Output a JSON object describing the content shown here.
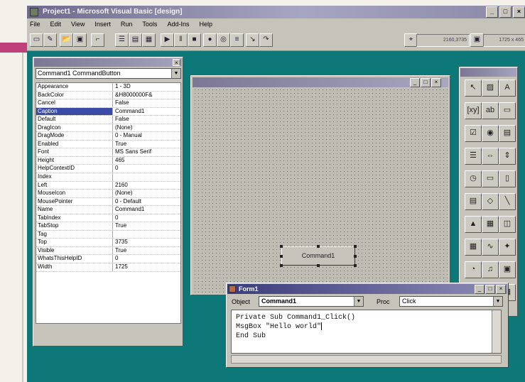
{
  "window": {
    "title": "Project1 - Microsoft Visual Basic [design]"
  },
  "menu": [
    "File",
    "Edit",
    "View",
    "Insert",
    "Run",
    "Tools",
    "Add-Ins",
    "Help"
  ],
  "toolbar": {
    "position_readout": "2160,3735",
    "size_readout": "1725 x 465"
  },
  "properties": {
    "object_selector": "Command1  CommandButton",
    "rows": [
      {
        "name": "Appearance",
        "value": "1 - 3D"
      },
      {
        "name": "BackColor",
        "value": "&H8000000F&"
      },
      {
        "name": "Cancel",
        "value": "False"
      },
      {
        "name": "Caption",
        "value": "Command1"
      },
      {
        "name": "Default",
        "value": "False"
      },
      {
        "name": "DragIcon",
        "value": "(None)"
      },
      {
        "name": "DragMode",
        "value": "0 - Manual"
      },
      {
        "name": "Enabled",
        "value": "True"
      },
      {
        "name": "Font",
        "value": "MS Sans Serif"
      },
      {
        "name": "Height",
        "value": "465"
      },
      {
        "name": "HelpContextID",
        "value": "0"
      },
      {
        "name": "Index",
        "value": ""
      },
      {
        "name": "Left",
        "value": "2160"
      },
      {
        "name": "MouseIcon",
        "value": "(None)"
      },
      {
        "name": "MousePointer",
        "value": "0 - Default"
      },
      {
        "name": "Name",
        "value": "Command1"
      },
      {
        "name": "TabIndex",
        "value": "0"
      },
      {
        "name": "TabStop",
        "value": "True"
      },
      {
        "name": "Tag",
        "value": ""
      },
      {
        "name": "Top",
        "value": "3735"
      },
      {
        "name": "Visible",
        "value": "True"
      },
      {
        "name": "WhatsThisHelpID",
        "value": "0"
      },
      {
        "name": "Width",
        "value": "1725"
      }
    ],
    "selected_row": "Caption"
  },
  "form": {
    "button_caption": "Command1"
  },
  "code_window": {
    "title": "Form1",
    "object_label": "Object",
    "object_value": "Command1",
    "proc_label": "Proc",
    "proc_value": "Click",
    "lines": [
      "Private Sub Command1_Click()",
      "MsgBox \"Hello world\"",
      "End Sub"
    ]
  },
  "toolbox_icons": [
    "pointer",
    "picturebox",
    "label",
    "frame",
    "textbox",
    "commandbutton",
    "checkbox",
    "optionbutton",
    "combobox",
    "listbox",
    "hscroll",
    "vscroll",
    "timer",
    "drivelist",
    "dirlist",
    "filelist",
    "shape",
    "line",
    "image",
    "data",
    "ole",
    "grid",
    "graph",
    "spin",
    "gauge",
    "mci",
    "commondialog",
    "animation",
    "toolbar",
    "listview"
  ]
}
